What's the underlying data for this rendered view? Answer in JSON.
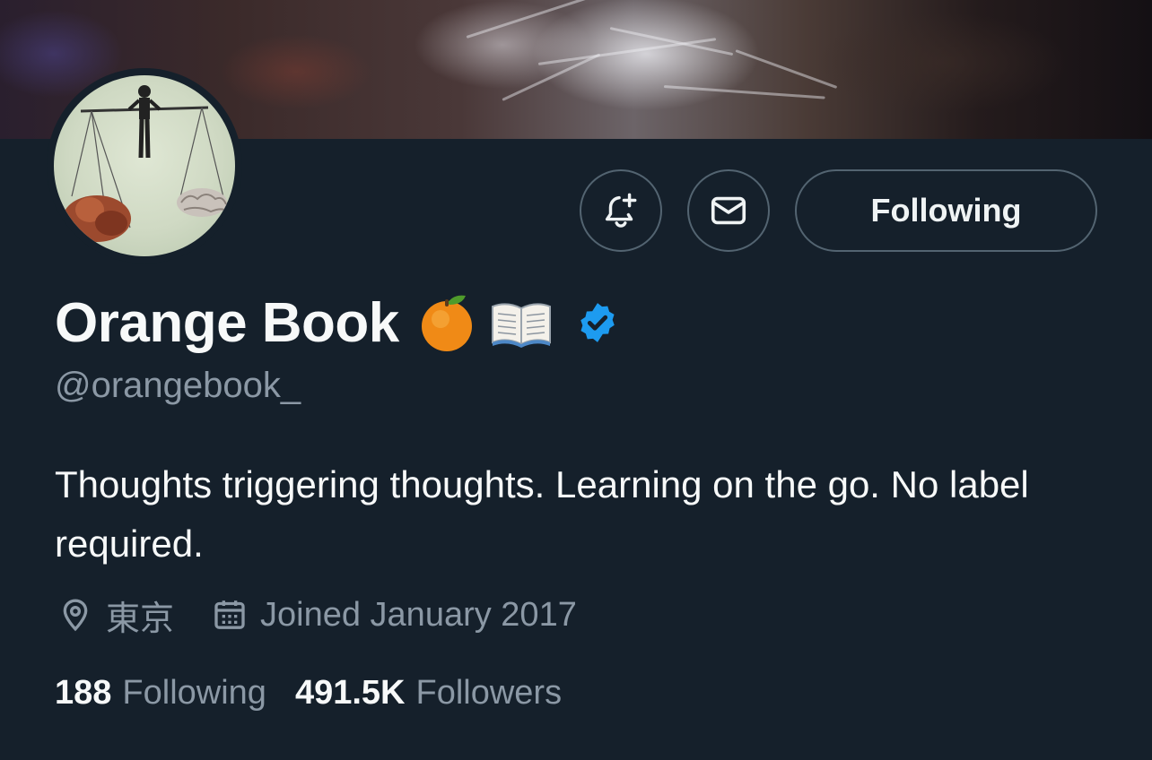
{
  "profile": {
    "display_name": "Orange Book",
    "handle": "@orangebook_",
    "verified": true,
    "bio": "Thoughts triggering thoughts. Learning on the go. No label required.",
    "location": "東京",
    "joined": "Joined January 2017"
  },
  "name_emojis": [
    "orange-emoji",
    "open-book-emoji",
    "verified-badge-icon"
  ],
  "actions": {
    "notify_icon": "bell-plus-icon",
    "message_icon": "envelope-icon",
    "follow_label": "Following"
  },
  "stats": {
    "following_count": "188",
    "following_label": "Following",
    "followers_count": "491.5K",
    "followers_label": "Followers"
  },
  "colors": {
    "background": "#15202b",
    "text_primary": "#f7f9f9",
    "text_secondary": "#8b98a5",
    "border": "#536471",
    "verified_blue": "#1d9bf0"
  }
}
